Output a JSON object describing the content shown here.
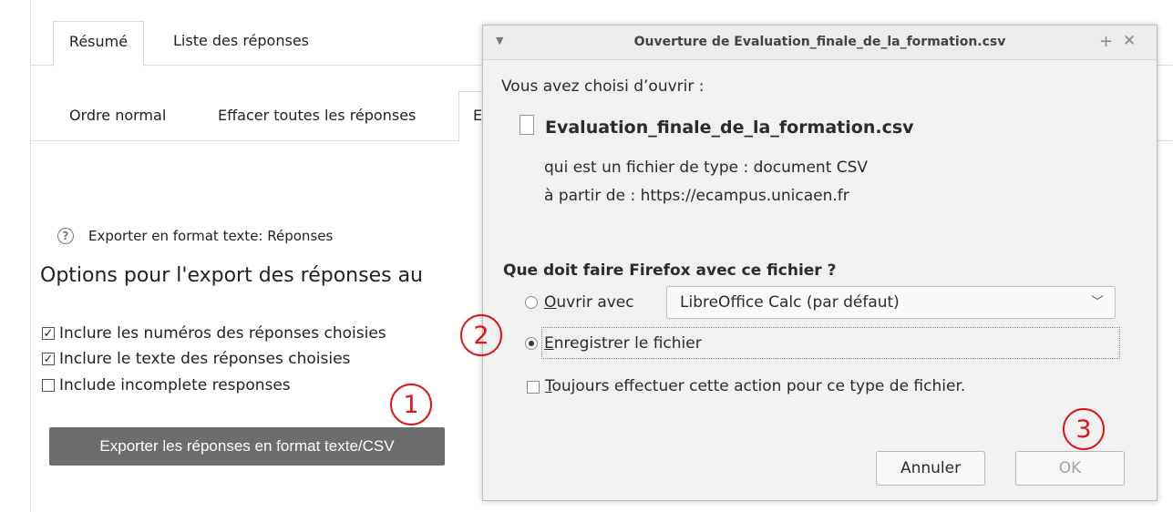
{
  "page": {
    "tabs_row1": [
      "Résumé",
      "Liste des réponses"
    ],
    "tabs_row2": [
      "Ordre normal",
      "Effacer toutes les réponses",
      "E"
    ],
    "help_text": "Exporter en format texte: Réponses",
    "options_title": "Options pour l'export des réponses au",
    "checkboxes": [
      {
        "label": "Inclure les numéros des réponses choisies",
        "checked": true
      },
      {
        "label": "Inclure le texte des réponses choisies",
        "checked": true
      },
      {
        "label": "Include incomplete responses",
        "checked": false
      }
    ],
    "export_button": "Exporter les réponses en format texte/CSV"
  },
  "dialog": {
    "title": "Ouverture de Evaluation_finale_de_la_formation.csv",
    "intro": "Vous avez choisi d’ouvrir :",
    "file_name": "Evaluation_finale_de_la_formation.csv",
    "file_type": "qui est un fichier de type : document CSV",
    "source": "à partir de : https://ecampus.unicaen.fr",
    "question": "Que doit faire Firefox avec ce fichier ?",
    "open_with_label": "Ouvrir avec",
    "open_with_app": "LibreOffice Calc (par défaut)",
    "save_label": "Enregistrer le fichier",
    "always_label": "Toujours effectuer cette action pour ce type de fichier.",
    "cancel_button": "Annuler",
    "ok_button": "OK",
    "selected_option": "save"
  },
  "annotations": [
    "1",
    "2",
    "3"
  ],
  "colors": {
    "annotation": "#e0121b",
    "export_button_bg": "#6d6d6d",
    "dialog_bg": "#f1f1f1"
  }
}
